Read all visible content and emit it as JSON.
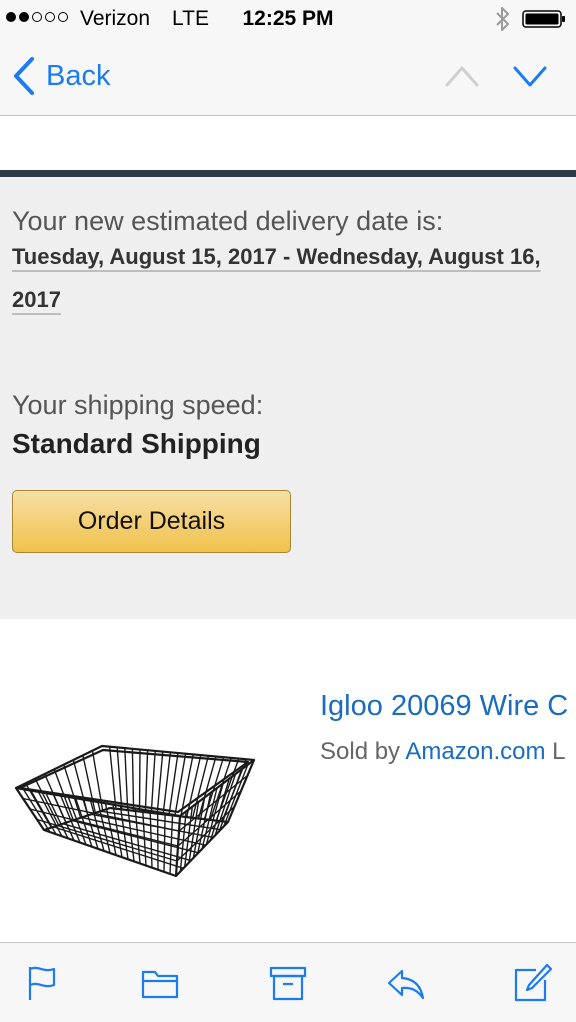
{
  "status_bar": {
    "carrier": "Verizon",
    "network": "LTE",
    "time": "12:25 PM",
    "signal_bars_filled": 2,
    "signal_bars_total": 5,
    "icons": [
      "bluetooth-icon",
      "battery-icon"
    ]
  },
  "nav": {
    "back_label": "Back",
    "icons": [
      "chevron-left-icon",
      "chevron-up-icon",
      "chevron-down-icon"
    ]
  },
  "email": {
    "delivery_label": "Your new estimated delivery date is:",
    "delivery_range": "Tuesday, August 15, 2017 - Wednesday, August 16,",
    "delivery_year": "2017",
    "shipping_label": "Your shipping speed:",
    "shipping_value": "Standard Shipping",
    "order_details_button": "Order Details"
  },
  "product": {
    "title": "Igloo 20069 Wire C",
    "sold_by_prefix": "Sold by ",
    "seller": "Amazon.com",
    "seller_suffix": " L",
    "image": "wire-basket-image"
  },
  "toolbar": {
    "items": [
      "flag-icon",
      "folder-icon",
      "archive-icon",
      "reply-icon",
      "compose-icon"
    ]
  },
  "colors": {
    "link_blue": "#1a7cf0",
    "divider_dark": "#2f3a48",
    "button_gold": "#f0c14b",
    "panel_gray": "#efefef"
  }
}
